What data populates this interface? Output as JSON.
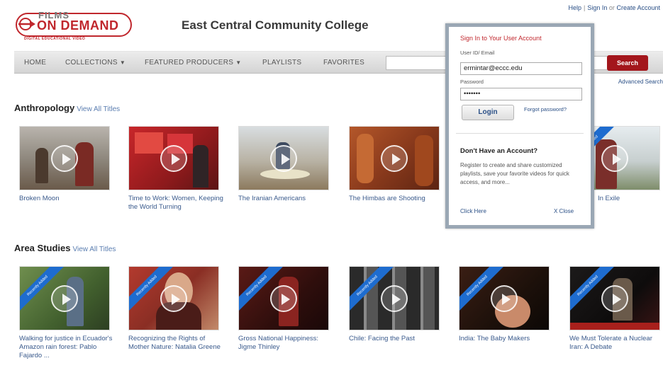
{
  "header": {
    "logo": {
      "films": "FILMS",
      "main": "ON DEMAND",
      "sub": "DIGITAL EDUCATIONAL VIDEO"
    },
    "college": "East Central Community College",
    "links": {
      "help": "Help",
      "sign_in": "Sign In",
      "or": "or",
      "create": "Create Account"
    }
  },
  "nav": {
    "items": [
      "HOME",
      "COLLECTIONS",
      "FEATURED PRODUCERS",
      "PLAYLISTS",
      "FAVORITES"
    ],
    "search_button": "Search",
    "advanced_search": "Advanced Search"
  },
  "sections": [
    {
      "title": "Anthropology",
      "view_all": "View All Titles",
      "items": [
        {
          "title": "Broken Moon",
          "recently_added": false
        },
        {
          "title": "Time to Work: Women, Keeping the World Turning",
          "recently_added": false
        },
        {
          "title": "The Iranian Americans",
          "recently_added": false
        },
        {
          "title": "The Himbas are Shooting",
          "recently_added": false
        },
        {
          "title": "",
          "recently_added": false
        },
        {
          "title": "In Exile",
          "recently_added": true
        }
      ]
    },
    {
      "title": "Area Studies",
      "view_all": "View All Titles",
      "items": [
        {
          "title": "Walking for justice in Ecuador's Amazon rain forest: Pablo Fajardo ...",
          "recently_added": true
        },
        {
          "title": "Recognizing the Rights of Mother Nature: Natalia Greene",
          "recently_added": true
        },
        {
          "title": "Gross National Happiness: Jigme Thinley",
          "recently_added": true
        },
        {
          "title": "Chile: Facing the Past",
          "recently_added": true
        },
        {
          "title": "India: The Baby Makers",
          "recently_added": true
        },
        {
          "title": "We Must Tolerate a Nuclear Iran: A Debate",
          "recently_added": true
        }
      ]
    }
  ],
  "ribbon_label": "Recently Added",
  "login": {
    "title": "Sign In to Your User Account",
    "user_label": "User ID/ Email",
    "user_value": "ermintar@eccc.edu",
    "password_label": "Password",
    "password_value": "•••••••",
    "login_button": "Login",
    "forgot": "Forgot password?",
    "no_account_title": "Don't Have an Account?",
    "no_account_text": "Register to create and share customized playlists, save your favorite videos for quick access, and more...",
    "click_here": "Click Here",
    "close": "X Close"
  },
  "colors": {
    "brand_red": "#c0272d",
    "link_blue": "#3a5a8c",
    "ribbon_blue": "#1e6ccf"
  }
}
